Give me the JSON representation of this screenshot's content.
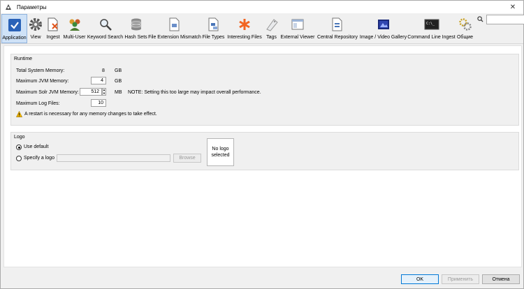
{
  "window": {
    "title": "Параметры"
  },
  "toolbar": {
    "items": [
      {
        "label": "Application",
        "icon": "checkbox-icon"
      },
      {
        "label": "View",
        "icon": "gear-icon"
      },
      {
        "label": "Ingest",
        "icon": "ingest-icon"
      },
      {
        "label": "Multi-User",
        "icon": "users-icon"
      },
      {
        "label": "Keyword Search",
        "icon": "magnifier-icon"
      },
      {
        "label": "Hash Sets",
        "icon": "database-icon"
      },
      {
        "label": "File Extension Mismatch",
        "icon": "file-mismatch-icon"
      },
      {
        "label": "File Types",
        "icon": "file-types-icon"
      },
      {
        "label": "Interesting Files",
        "icon": "asterisk-icon"
      },
      {
        "label": "Tags",
        "icon": "tag-icon"
      },
      {
        "label": "External Viewer",
        "icon": "window-icon"
      },
      {
        "label": "Central Repository",
        "icon": "repository-icon"
      },
      {
        "label": "Image / Video Gallery",
        "icon": "gallery-icon"
      },
      {
        "label": "Command Line Ingest",
        "icon": "terminal-icon"
      },
      {
        "label": "Общие",
        "icon": "gears-icon"
      }
    ],
    "search_placeholder": ""
  },
  "runtime": {
    "title": "Runtime",
    "total_memory_label": "Total System Memory:",
    "total_memory_value": "8",
    "total_memory_unit": "GB",
    "max_jvm_label": "Maximum JVM Memory:",
    "max_jvm_value": "4",
    "max_jvm_unit": "GB",
    "max_solr_label": "Maximum Solr JVM Memory:",
    "max_solr_value": "512",
    "max_solr_unit": "MB",
    "solr_note": "NOTE:  Setting this too large may impact overall performance.",
    "max_log_label": "Maximum Log Files:",
    "max_log_value": "10",
    "restart_warning": "A restart is necessary for any memory changes to take effect."
  },
  "logo": {
    "title": "Logo",
    "use_default_label": "Use default",
    "specify_label": "Specify a logo",
    "path_value": "",
    "browse_label": "Browse",
    "preview_text": "No logo\nselected"
  },
  "footer": {
    "ok_label": "OK",
    "apply_label": "Применить",
    "cancel_label": "Отмена"
  },
  "colors": {
    "accent": "#0078d7",
    "selected_tab": "#cfe2f7",
    "warning": "#f0b400"
  }
}
